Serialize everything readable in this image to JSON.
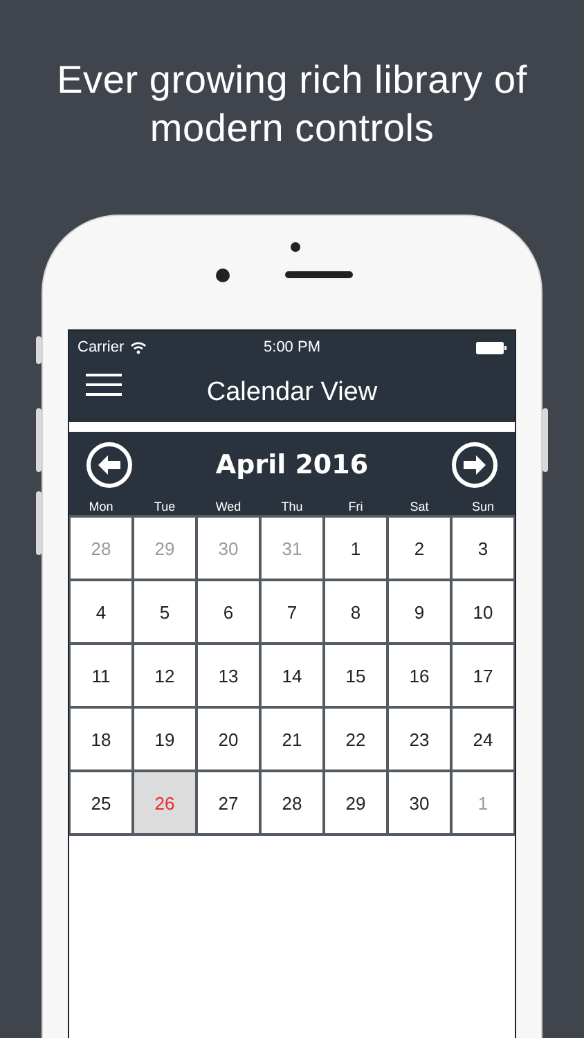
{
  "headline": "Ever growing rich library of modern controls",
  "status_bar": {
    "carrier": "Carrier",
    "time": "5:00 PM"
  },
  "nav_bar": {
    "title": "Calendar View"
  },
  "calendar": {
    "month": "April 2016",
    "weekdays": [
      "Mon",
      "Tue",
      "Wed",
      "Thu",
      "Fri",
      "Sat",
      "Sun"
    ],
    "days": [
      {
        "day": "28",
        "muted": true,
        "selected": false
      },
      {
        "day": "29",
        "muted": true,
        "selected": false
      },
      {
        "day": "30",
        "muted": true,
        "selected": false
      },
      {
        "day": "31",
        "muted": true,
        "selected": false
      },
      {
        "day": "1",
        "muted": false,
        "selected": false
      },
      {
        "day": "2",
        "muted": false,
        "selected": false
      },
      {
        "day": "3",
        "muted": false,
        "selected": false
      },
      {
        "day": "4",
        "muted": false,
        "selected": false
      },
      {
        "day": "5",
        "muted": false,
        "selected": false
      },
      {
        "day": "6",
        "muted": false,
        "selected": false
      },
      {
        "day": "7",
        "muted": false,
        "selected": false
      },
      {
        "day": "8",
        "muted": false,
        "selected": false
      },
      {
        "day": "9",
        "muted": false,
        "selected": false
      },
      {
        "day": "10",
        "muted": false,
        "selected": false
      },
      {
        "day": "11",
        "muted": false,
        "selected": false
      },
      {
        "day": "12",
        "muted": false,
        "selected": false
      },
      {
        "day": "13",
        "muted": false,
        "selected": false
      },
      {
        "day": "14",
        "muted": false,
        "selected": false
      },
      {
        "day": "15",
        "muted": false,
        "selected": false
      },
      {
        "day": "16",
        "muted": false,
        "selected": false
      },
      {
        "day": "17",
        "muted": false,
        "selected": false
      },
      {
        "day": "18",
        "muted": false,
        "selected": false
      },
      {
        "day": "19",
        "muted": false,
        "selected": false
      },
      {
        "day": "20",
        "muted": false,
        "selected": false
      },
      {
        "day": "21",
        "muted": false,
        "selected": false
      },
      {
        "day": "22",
        "muted": false,
        "selected": false
      },
      {
        "day": "23",
        "muted": false,
        "selected": false
      },
      {
        "day": "24",
        "muted": false,
        "selected": false
      },
      {
        "day": "25",
        "muted": false,
        "selected": false
      },
      {
        "day": "26",
        "muted": false,
        "selected": true
      },
      {
        "day": "27",
        "muted": false,
        "selected": false
      },
      {
        "day": "28",
        "muted": false,
        "selected": false
      },
      {
        "day": "29",
        "muted": false,
        "selected": false
      },
      {
        "day": "30",
        "muted": false,
        "selected": false
      },
      {
        "day": "1",
        "muted": true,
        "selected": false
      }
    ]
  }
}
